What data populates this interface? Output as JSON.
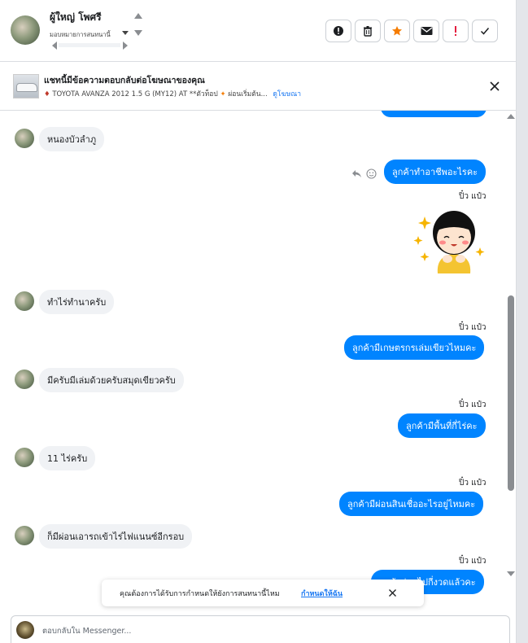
{
  "header": {
    "contact_name": "ผู้ใหญ่ โพศรี",
    "assign_label": "มอบหมายการสนทนานี้",
    "actions": [
      {
        "name": "mark-spam-button",
        "icon": "exclamation-circle-icon"
      },
      {
        "name": "delete-button",
        "icon": "trash-icon"
      },
      {
        "name": "star-button",
        "icon": "star-icon",
        "color": "#f57c00"
      },
      {
        "name": "mark-unread-button",
        "icon": "envelope-icon"
      },
      {
        "name": "follow-up-button",
        "icon": "exclamation-icon",
        "color": "#e41e3f"
      },
      {
        "name": "mark-done-button",
        "icon": "check-icon"
      }
    ]
  },
  "ad_banner": {
    "title": "แชทนี้มีข้อความตอบกลับต่อโฆษณาของคุณ",
    "subtitle": "TOYOTA AVANZA 2012 1.5 G (MY12) AT **ตัวท็อป",
    "subtitle_tail": "ผ่อนเริ่มต้น...",
    "view_ad_link": "ดูโฆษณา"
  },
  "messages": [
    {
      "direction": "in",
      "text": "หนองบัวลำภู"
    },
    {
      "direction": "out",
      "text": "ลูกค้าทำอาชีพอะไรคะ"
    },
    {
      "direction": "out",
      "sender": "ปิ๋ว แป๋ว",
      "type": "sticker",
      "sticker_icon": "sparkle-girl-sticker"
    },
    {
      "direction": "in",
      "text": "ทำไร่ทำนาครับ"
    },
    {
      "direction": "out",
      "sender": "ปิ๋ว แป๋ว",
      "text": "ลูกค้ามีเกษตรกรเล่มเขียวไหมคะ"
    },
    {
      "direction": "in",
      "text": "มีครับมีเล่มด้วยครับสมุดเขียวครับ"
    },
    {
      "direction": "out",
      "sender": "ปิ๋ว แป๋ว",
      "text": "ลูกค้ามีพื้นที่กี่ไร่คะ"
    },
    {
      "direction": "in",
      "text": "11 ไร่ครับ"
    },
    {
      "direction": "out",
      "sender": "ปิ๋ว แป๋ว",
      "text": "ลูกค้ามีผ่อนสินเชื่ออะไรอยู่ไหมคะ"
    },
    {
      "direction": "in",
      "text": "ก็มีผ่อนเอารถเข้าไร่ไฟแนนซ์อีกรอบ"
    },
    {
      "direction": "out",
      "sender": "ปิ๋ว แป๋ว",
      "text": "ลูกค้าผ่อนไปกี่งวดแล้วคะ"
    }
  ],
  "toast": {
    "text": "คุณต้องการได้รับการกำหนดให้ยังการสนทนานี้ไหม",
    "link": "กำหนดให้ฉัน"
  },
  "composer": {
    "placeholder": "ตอบกลับใน Messenger..."
  },
  "colors": {
    "outgoing_bubble": "#0084ff",
    "incoming_bubble": "#f0f2f5",
    "link": "#1877f2"
  }
}
